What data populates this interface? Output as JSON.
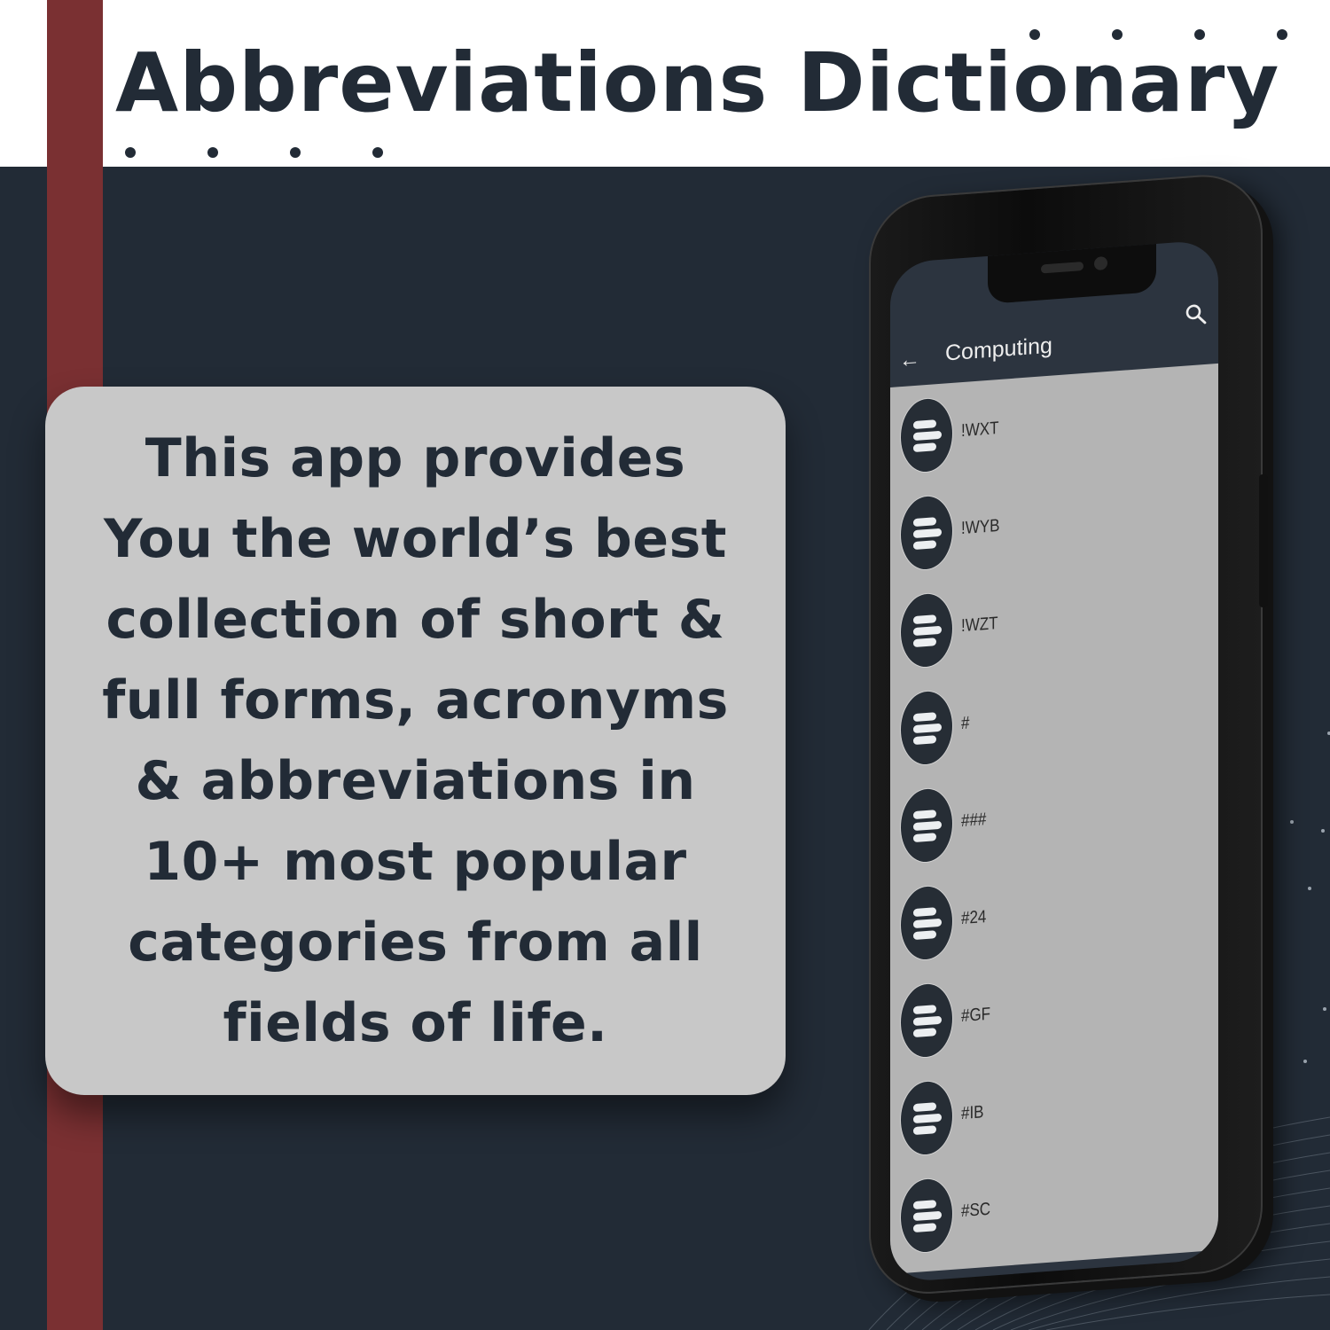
{
  "header": {
    "title": "Abbreviations Dictionary"
  },
  "card": {
    "lines": [
      "This app provides",
      "You the world’s best",
      "collection of short &",
      "full forms, acronyms",
      "& abbreviations in",
      "10+ most popular",
      "categories from all",
      "fields of life."
    ]
  },
  "colors": {
    "background": "#222b36",
    "accent_bar": "#7a3032",
    "card": "#c8c8c8",
    "text_dark": "#222b36",
    "list_bg": "#b4b4b4"
  },
  "phone": {
    "appbar": {
      "back_icon": "arrow-left-icon",
      "title": "Computing",
      "search_icon": "search-icon"
    },
    "list_items": [
      {
        "label": "!WXT",
        "icon": "menu-lines-icon"
      },
      {
        "label": "!WYB",
        "icon": "menu-lines-icon"
      },
      {
        "label": "!WZT",
        "icon": "menu-lines-icon"
      },
      {
        "label": "#",
        "icon": "menu-lines-icon"
      },
      {
        "label": "###",
        "icon": "menu-lines-icon"
      },
      {
        "label": "#24",
        "icon": "menu-lines-icon"
      },
      {
        "label": "#GF",
        "icon": "menu-lines-icon"
      },
      {
        "label": "#IB",
        "icon": "menu-lines-icon"
      },
      {
        "label": "#SC",
        "icon": "menu-lines-icon"
      }
    ]
  }
}
